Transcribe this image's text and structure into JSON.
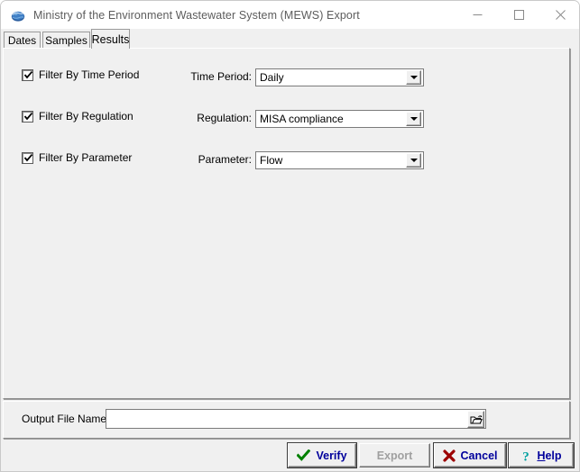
{
  "window": {
    "title": "Ministry of the Environment Wastewater System (MEWS) Export",
    "app_icon": "globe-icon",
    "controls": {
      "minimize": "—",
      "maximize": "□",
      "close": "✕"
    }
  },
  "tabs": [
    {
      "label": "Dates",
      "selected": false
    },
    {
      "label": "Samples",
      "selected": false
    },
    {
      "label": "Results",
      "selected": true
    }
  ],
  "results_tab": {
    "filters": [
      {
        "checkbox_label": "Filter By Time Period",
        "checked": true,
        "field_label": "Time Period:",
        "value": "Daily",
        "options": [
          "Daily"
        ]
      },
      {
        "checkbox_label": "Filter By Regulation",
        "checked": true,
        "field_label": "Regulation:",
        "value": "MISA compliance",
        "options": [
          "MISA compliance"
        ]
      },
      {
        "checkbox_label": "Filter By Parameter",
        "checked": true,
        "field_label": "Parameter:",
        "value": "Flow",
        "options": [
          "Flow"
        ]
      }
    ]
  },
  "output": {
    "label": "Output File Name:",
    "value": "",
    "placeholder": "",
    "browse_icon": "open-folder-icon"
  },
  "buttons": [
    {
      "label": "Verify",
      "icon": "green-check-icon",
      "enabled": true,
      "accel": ""
    },
    {
      "label": "Export",
      "icon": "",
      "enabled": false,
      "accel": ""
    },
    {
      "label": "Cancel",
      "icon": "red-x-icon",
      "enabled": true,
      "accel": ""
    },
    {
      "label": "Help",
      "icon": "question-mark-icon",
      "enabled": true,
      "accel": "H"
    }
  ],
  "colors": {
    "window_bg": "#f0f0f0",
    "titlebar_bg": "#ffffff",
    "title_text": "#5c5c5c",
    "button_text": "#00009c",
    "disabled_text": "#a0a0a0",
    "check_green": "#008000",
    "cancel_red": "#9c0000",
    "help_teal": "#008b8b",
    "field_bg": "#ffffff",
    "border": "#7b7b7b"
  }
}
